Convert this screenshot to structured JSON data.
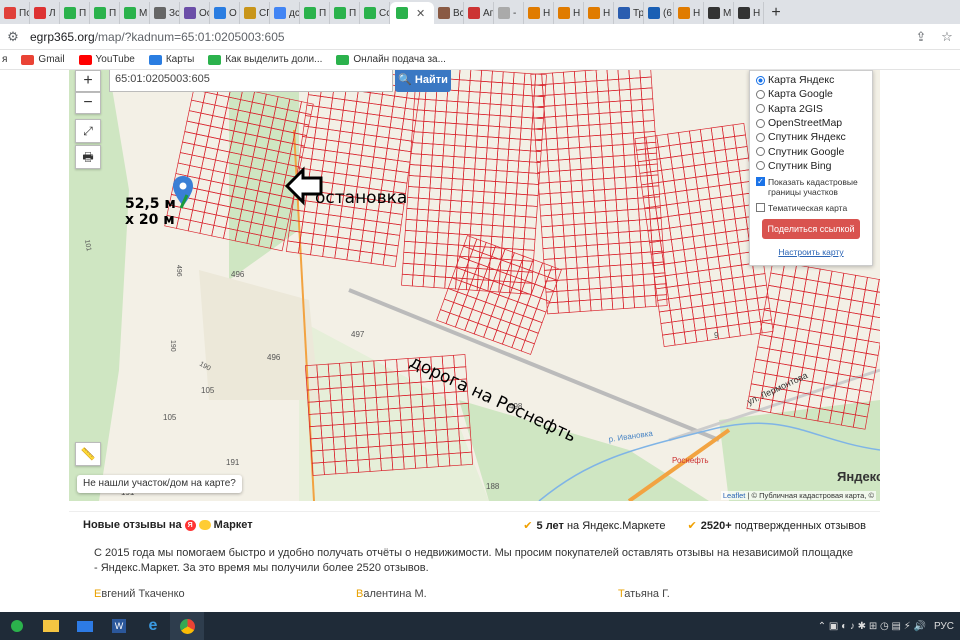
{
  "browser": {
    "tabs": [
      {
        "label": "Пс",
        "color": "#e0403a"
      },
      {
        "label": "Л",
        "color": "#d33"
      },
      {
        "label": "П",
        "color": "#2bb24c"
      },
      {
        "label": "П",
        "color": "#2bb24c"
      },
      {
        "label": "М",
        "color": "#2bb24c"
      },
      {
        "label": "Зс",
        "color": "#666"
      },
      {
        "label": "Ос",
        "color": "#6b4ea8"
      },
      {
        "label": "О",
        "color": "#2a7de1"
      },
      {
        "label": "СГ",
        "color": "#c8951a"
      },
      {
        "label": "дс",
        "color": "#4285f4"
      },
      {
        "label": "П",
        "color": "#2bb24c"
      },
      {
        "label": "П",
        "color": "#2bb24c"
      },
      {
        "label": "Сс",
        "color": "#2bb24c"
      }
    ],
    "active_tab": {
      "label": "",
      "color": "#2bb24c"
    },
    "tabs_right": [
      {
        "label": "Вс",
        "color": "#8a5a44"
      },
      {
        "label": "Аг",
        "color": "#c33"
      },
      {
        "label": "-",
        "color": "#aaa"
      },
      {
        "label": "Н",
        "color": "#e07b00"
      },
      {
        "label": "Н",
        "color": "#e07b00"
      },
      {
        "label": "Н",
        "color": "#e07b00"
      },
      {
        "label": "Тр",
        "color": "#2a5db0"
      },
      {
        "label": "(6",
        "color": "#1a5fb4"
      },
      {
        "label": "Н",
        "color": "#e07b00"
      },
      {
        "label": "М",
        "color": "#333"
      },
      {
        "label": "Н",
        "color": "#333"
      }
    ],
    "new_tab_label": "+",
    "url_host": "egrp365.org",
    "url_path": "/map/?kadnum=65:01:0205003:605",
    "bookmarks": [
      {
        "label": "я",
        "color": "#fff"
      },
      {
        "label": "Gmail",
        "color": "#ea4335"
      },
      {
        "label": "YouTube",
        "color": "#ff0000"
      },
      {
        "label": "Карты",
        "color": "#2a7de1"
      },
      {
        "label": "Как выделить доли...",
        "color": "#2bb24c"
      },
      {
        "label": "Онлайн подача за...",
        "color": "#2bb24c"
      }
    ]
  },
  "map": {
    "search_value": "65:01:0205003:605",
    "search_button": "Найти",
    "zoom_in": "+",
    "zoom_out": "−",
    "layers": [
      {
        "label": "Карта Яндекс",
        "selected": true
      },
      {
        "label": "Карта Google",
        "selected": false
      },
      {
        "label": "Карта 2GIS",
        "selected": false
      },
      {
        "label": "OpenStreetMap",
        "selected": false
      },
      {
        "label": "Спутник Яндекс",
        "selected": false
      },
      {
        "label": "Спутник Google",
        "selected": false
      },
      {
        "label": "Спутник Bing",
        "selected": false
      }
    ],
    "show_cadastral": "Показать кадастровые границы участков",
    "thematic": "Тематическая карта",
    "share_button": "Поделиться ссылкой",
    "setup_link": "Настроить карту",
    "not_found": "Не нашли участок/дом на карте?",
    "attribution_leaflet": "Leaflet",
    "attribution_rest": " | © Публичная кадастровая карта, ©",
    "yandex_logo": "Яндекс",
    "annotations": {
      "size_line1": "52,5 м",
      "size_line2": "х 20 м",
      "stop": "остановка",
      "road": "дорога на Роснефть"
    },
    "labels": {
      "street": "ул. Лермонтова",
      "river": "р. Ивановка",
      "rosneft": "Роснефть",
      "n496a": "496",
      "n496b": "496",
      "n496c": "496",
      "n497": "497",
      "n498": "498",
      "n191": "191",
      "n190": "190",
      "n105a": "105",
      "n105b": "105",
      "n188": "188",
      "n101": "101",
      "n9": "9"
    },
    "colors": {
      "parcel": "#d9262f",
      "road": "#f2a341",
      "green": "#cfe6c2",
      "base": "#f3f0e6"
    }
  },
  "reviews": {
    "title": "Новые отзывы на",
    "market": "Маркет",
    "badge1_bold": "5 лет",
    "badge1_rest": " на Яндекс.Маркете",
    "badge2_bold": "2520+",
    "badge2_rest": " подтвержденных отзывов",
    "text": "С 2015 года мы помогаем быстро и удобно получать отчёты о недвижимости. Мы просим покупателей оставлять отзывы на независимой площадке - Яндекс.Маркет. За это время мы получили более 2520 отзывов.",
    "names": [
      {
        "cap": "Е",
        "rest": "вгений Ткаченко"
      },
      {
        "cap": "В",
        "rest": "алентина М."
      },
      {
        "cap": "Т",
        "rest": "атьяна Г."
      }
    ]
  },
  "taskbar": {
    "lang": "РУС"
  }
}
